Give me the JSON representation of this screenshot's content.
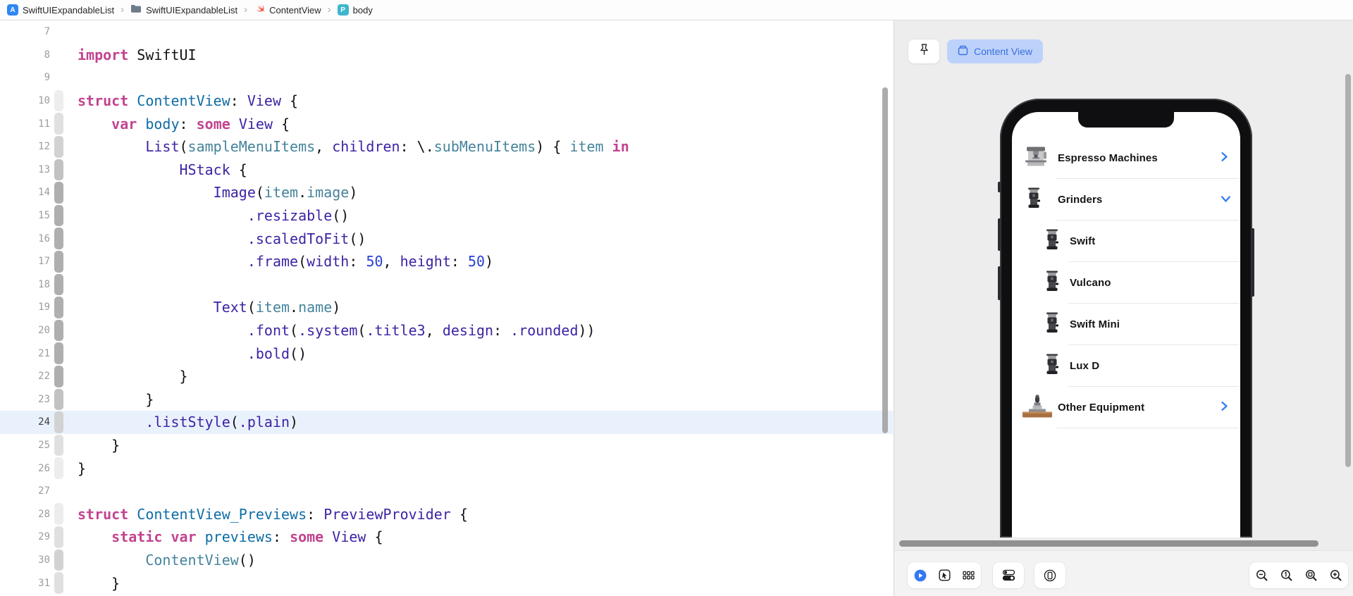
{
  "colors": {
    "accent_blue": "#3478f6",
    "pill_bg": "#bdd2fa",
    "pill_text": "#3a6fe0",
    "keyword_pink": "#c2438f",
    "type_purple": "#3e23a4",
    "declaration_blue": "#0e6ca5",
    "project_teal": "#45839b",
    "number_blue": "#2840d4",
    "canvas_gray": "#ededed",
    "line_highlight": "#e9f1fc"
  },
  "breadcrumb": {
    "separator": "›",
    "items": [
      {
        "icon": "app-icon",
        "label": "SwiftUIExpandableList"
      },
      {
        "icon": "folder-icon",
        "label": "SwiftUIExpandableList"
      },
      {
        "icon": "swift-icon",
        "label": "ContentView"
      },
      {
        "icon": "property-icon",
        "label": "body",
        "badge_letter": "P"
      }
    ]
  },
  "editor": {
    "highlighted_line": 24,
    "ribbon_shades": [
      "",
      "#ededed",
      "#e0e0e0",
      "#d2d2d2",
      "#c2c2c2",
      "#afafaf"
    ],
    "lines": [
      {
        "n": 7,
        "ind": 0,
        "d": 0,
        "tk": []
      },
      {
        "n": 8,
        "ind": 0,
        "d": 0,
        "tk": [
          [
            "kw",
            "import"
          ],
          [
            "pl",
            " SwiftUI"
          ]
        ]
      },
      {
        "n": 9,
        "ind": 0,
        "d": 0,
        "tk": []
      },
      {
        "n": 10,
        "ind": 0,
        "d": 1,
        "tk": [
          [
            "kw",
            "struct"
          ],
          [
            "pl",
            " "
          ],
          [
            "de",
            "ContentView"
          ],
          [
            "pl",
            ": "
          ],
          [
            "ty",
            "View"
          ],
          [
            "pl",
            " {"
          ]
        ]
      },
      {
        "n": 11,
        "ind": 4,
        "d": 2,
        "tk": [
          [
            "kw",
            "var"
          ],
          [
            "pl",
            " "
          ],
          [
            "de",
            "body"
          ],
          [
            "pl",
            ": "
          ],
          [
            "kw",
            "some"
          ],
          [
            "pl",
            " "
          ],
          [
            "ty",
            "View"
          ],
          [
            "pl",
            " {"
          ]
        ]
      },
      {
        "n": 12,
        "ind": 8,
        "d": 3,
        "tk": [
          [
            "ty",
            "List"
          ],
          [
            "pl",
            "("
          ],
          [
            "pr",
            "sampleMenuItems"
          ],
          [
            "pl",
            ", "
          ],
          [
            "ty",
            "children"
          ],
          [
            "pl",
            ": \\."
          ],
          [
            "pr",
            "subMenuItems"
          ],
          [
            "pl",
            ") { "
          ],
          [
            "pr",
            "item"
          ],
          [
            "pl",
            " "
          ],
          [
            "kw",
            "in"
          ]
        ]
      },
      {
        "n": 13,
        "ind": 12,
        "d": 4,
        "tk": [
          [
            "ty",
            "HStack"
          ],
          [
            "pl",
            " {"
          ]
        ]
      },
      {
        "n": 14,
        "ind": 16,
        "d": 5,
        "tk": [
          [
            "ty",
            "Image"
          ],
          [
            "pl",
            "("
          ],
          [
            "pr",
            "item"
          ],
          [
            "pl",
            "."
          ],
          [
            "pr",
            "image"
          ],
          [
            "pl",
            ")"
          ]
        ]
      },
      {
        "n": 15,
        "ind": 20,
        "d": 5,
        "tk": [
          [
            "ty",
            ".resizable"
          ],
          [
            "pl",
            "()"
          ]
        ]
      },
      {
        "n": 16,
        "ind": 20,
        "d": 5,
        "tk": [
          [
            "ty",
            ".scaledToFit"
          ],
          [
            "pl",
            "()"
          ]
        ]
      },
      {
        "n": 17,
        "ind": 20,
        "d": 5,
        "tk": [
          [
            "ty",
            ".frame"
          ],
          [
            "pl",
            "("
          ],
          [
            "ty",
            "width"
          ],
          [
            "pl",
            ": "
          ],
          [
            "nu",
            "50"
          ],
          [
            "pl",
            ", "
          ],
          [
            "ty",
            "height"
          ],
          [
            "pl",
            ": "
          ],
          [
            "nu",
            "50"
          ],
          [
            "pl",
            ")"
          ]
        ]
      },
      {
        "n": 18,
        "ind": 0,
        "d": 5,
        "tk": []
      },
      {
        "n": 19,
        "ind": 16,
        "d": 5,
        "tk": [
          [
            "ty",
            "Text"
          ],
          [
            "pl",
            "("
          ],
          [
            "pr",
            "item"
          ],
          [
            "pl",
            "."
          ],
          [
            "pr",
            "name"
          ],
          [
            "pl",
            ")"
          ]
        ]
      },
      {
        "n": 20,
        "ind": 20,
        "d": 5,
        "tk": [
          [
            "ty",
            ".font"
          ],
          [
            "pl",
            "("
          ],
          [
            "ty",
            ".system"
          ],
          [
            "pl",
            "("
          ],
          [
            "ty",
            ".title3"
          ],
          [
            "pl",
            ", "
          ],
          [
            "ty",
            "design"
          ],
          [
            "pl",
            ": "
          ],
          [
            "ty",
            ".rounded"
          ],
          [
            "pl",
            "))"
          ]
        ]
      },
      {
        "n": 21,
        "ind": 20,
        "d": 5,
        "tk": [
          [
            "ty",
            ".bold"
          ],
          [
            "pl",
            "()"
          ]
        ]
      },
      {
        "n": 22,
        "ind": 12,
        "d": 5,
        "tk": [
          [
            "pl",
            "}"
          ]
        ]
      },
      {
        "n": 23,
        "ind": 8,
        "d": 4,
        "tk": [
          [
            "pl",
            "}"
          ]
        ]
      },
      {
        "n": 24,
        "ind": 8,
        "d": 3,
        "tk": [
          [
            "ty",
            ".listStyle"
          ],
          [
            "pl",
            "("
          ],
          [
            "ty",
            ".plain"
          ],
          [
            "pl",
            ")"
          ]
        ]
      },
      {
        "n": 25,
        "ind": 4,
        "d": 2,
        "tk": [
          [
            "pl",
            "}"
          ]
        ]
      },
      {
        "n": 26,
        "ind": 0,
        "d": 1,
        "tk": [
          [
            "pl",
            "}"
          ]
        ]
      },
      {
        "n": 27,
        "ind": 0,
        "d": 0,
        "tk": []
      },
      {
        "n": 28,
        "ind": 0,
        "d": 1,
        "tk": [
          [
            "kw",
            "struct"
          ],
          [
            "pl",
            " "
          ],
          [
            "de",
            "ContentView_Previews"
          ],
          [
            "pl",
            ": "
          ],
          [
            "ty",
            "PreviewProvider"
          ],
          [
            "pl",
            " {"
          ]
        ]
      },
      {
        "n": 29,
        "ind": 4,
        "d": 2,
        "tk": [
          [
            "kw",
            "static"
          ],
          [
            "pl",
            " "
          ],
          [
            "kw",
            "var"
          ],
          [
            "pl",
            " "
          ],
          [
            "de",
            "previews"
          ],
          [
            "pl",
            ": "
          ],
          [
            "kw",
            "some"
          ],
          [
            "pl",
            " "
          ],
          [
            "ty",
            "View"
          ],
          [
            "pl",
            " {"
          ]
        ]
      },
      {
        "n": 30,
        "ind": 8,
        "d": 3,
        "tk": [
          [
            "pr",
            "ContentView"
          ],
          [
            "pl",
            "()"
          ]
        ]
      },
      {
        "n": 31,
        "ind": 4,
        "d": 2,
        "tk": [
          [
            "pl",
            "}"
          ]
        ]
      }
    ]
  },
  "preview": {
    "tab_label": "Content View",
    "rows": [
      {
        "label": "Espresso Machines",
        "level": 0,
        "icon": "espresso-machine-image",
        "accessory": "chevron-right"
      },
      {
        "label": "Grinders",
        "level": 0,
        "icon": "grinder-image",
        "accessory": "chevron-down"
      },
      {
        "label": "Swift",
        "level": 1,
        "icon": "grinder-image"
      },
      {
        "label": "Vulcano",
        "level": 1,
        "icon": "grinder-image"
      },
      {
        "label": "Swift Mini",
        "level": 1,
        "icon": "grinder-image"
      },
      {
        "label": "Lux D",
        "level": 1,
        "icon": "grinder-image"
      },
      {
        "label": "Other Equipment",
        "level": 0,
        "icon": "tamper-image",
        "accessory": "chevron-right"
      }
    ],
    "toolbar": [
      "live-preview",
      "selectable-mode",
      "grid-variants",
      "variants",
      "device-settings",
      "zoom-out",
      "zoom-100",
      "zoom-fit",
      "zoom-in"
    ]
  }
}
